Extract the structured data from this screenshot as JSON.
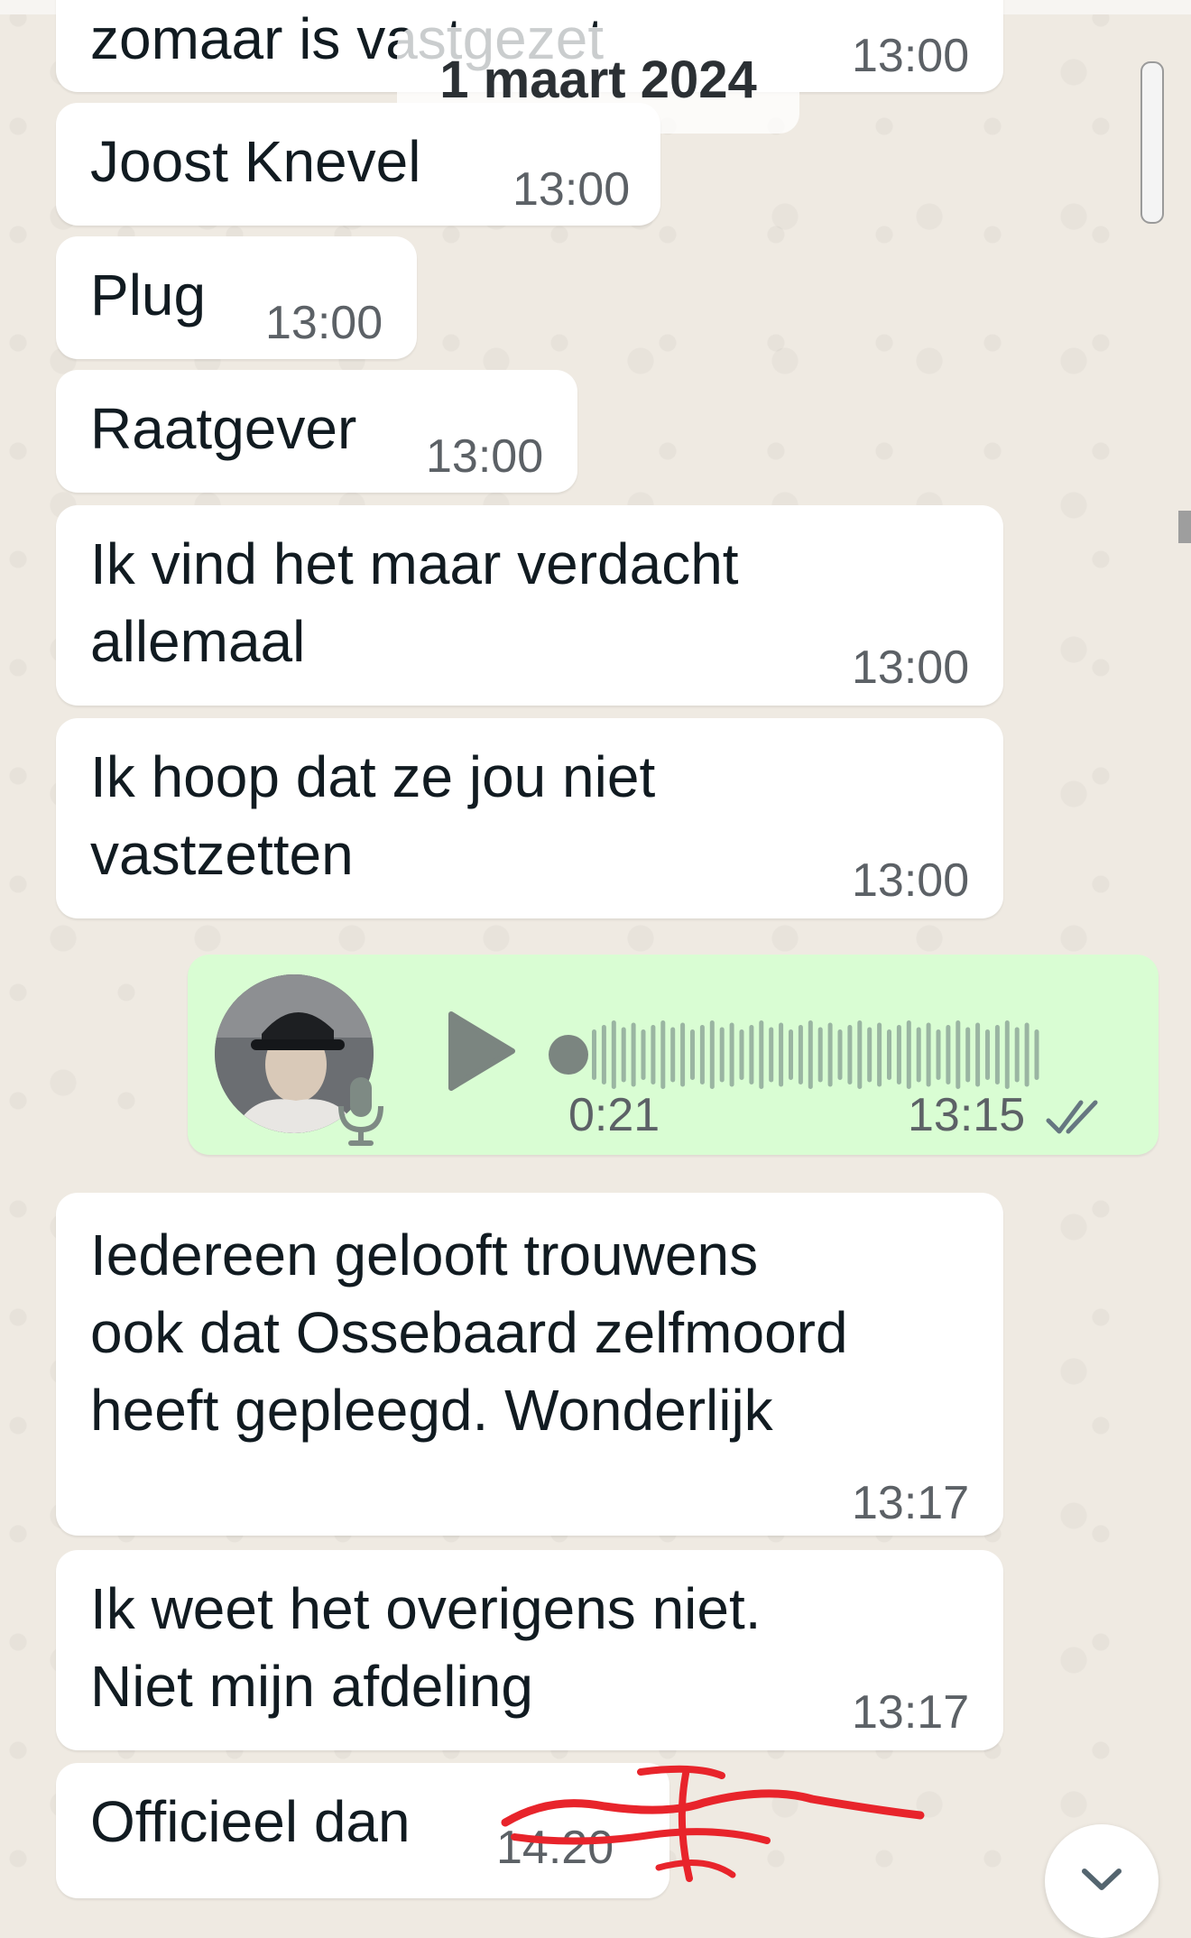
{
  "date_chip": "1 maart 2024",
  "messages": [
    {
      "text": "zomaar is vastgezet",
      "time": "13:00"
    },
    {
      "text": "Joost Knevel",
      "time": "13:00"
    },
    {
      "text": "Plug",
      "time": "13:00"
    },
    {
      "text": "Raatgever",
      "time": "13:00"
    },
    {
      "lines": [
        "Ik vind het maar verdacht",
        "allemaal"
      ],
      "time": "13:00"
    },
    {
      "lines": [
        "Ik hoop dat ze jou niet",
        "vastzetten"
      ],
      "time": "13:00"
    },
    {
      "lines": [
        "Iedereen gelooft trouwens",
        "ook dat Ossebaard zelfmoord",
        "heeft gepleegd. Wonderlijk"
      ],
      "time": "13:17"
    },
    {
      "lines": [
        "Ik weet het overigens niet.",
        "Niet mijn afdeling"
      ],
      "time": "13:17"
    },
    {
      "text": "Officieel dan",
      "time": "14:20"
    }
  ],
  "voice_message": {
    "duration": "0:21",
    "time": "13:15",
    "status": "read",
    "playback_progress": 0
  },
  "icons": {
    "play": "play-icon",
    "mic": "mic-icon",
    "read_receipt": "double-check-icon",
    "scroll_down": "chevron-down-icon"
  },
  "colors": {
    "background": "#efeae2",
    "incoming_bubble": "#ffffff",
    "outgoing_bubble": "#d9fdd3",
    "timestamp": "#5c6166",
    "annotation": "#e8242b"
  }
}
